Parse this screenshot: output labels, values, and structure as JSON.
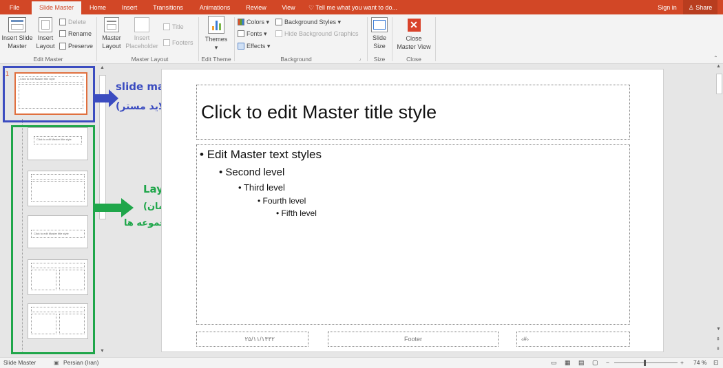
{
  "tabs": [
    "File",
    "Slide Master",
    "Home",
    "Insert",
    "Transitions",
    "Animations",
    "Review",
    "View"
  ],
  "tell_me": "Tell me what you want to do...",
  "sign_in": "Sign in",
  "share": "Share",
  "ribbon": {
    "insert_slide_master": [
      "Insert Slide",
      "Master"
    ],
    "insert_layout": [
      "Insert",
      "Layout"
    ],
    "delete": "Delete",
    "rename": "Rename",
    "preserve": "Preserve",
    "group_edit_master": "Edit Master",
    "master_layout": [
      "Master",
      "Layout"
    ],
    "insert_placeholder": [
      "Insert",
      "Placeholder"
    ],
    "title_cb": "Title",
    "footers_cb": "Footers",
    "group_master_layout": "Master Layout",
    "themes": "Themes",
    "group_edit_theme": "Edit Theme",
    "colors": "Colors",
    "fonts": "Fonts",
    "effects": "Effects",
    "background_styles": "Background Styles",
    "hide_bg": "Hide Background Graphics",
    "group_background": "Background",
    "slide_size": [
      "Slide",
      "Size"
    ],
    "group_size": "Size",
    "close_master": [
      "Close",
      "Master View"
    ],
    "group_close": "Close"
  },
  "thumb_number": "1",
  "thumb_title": "Click to edit Master title style",
  "slide": {
    "title": "Click to edit Master title style",
    "levels": [
      "Edit Master text styles",
      "Second level",
      "Third level",
      "Fourth level",
      "Fifth level"
    ],
    "date": "۲۵/۱۱/۱۴۴۲",
    "footer": "Footer",
    "number": "‹#›"
  },
  "annotations": {
    "slide_master": "slide master",
    "slide_master_fa": "(اسلاید مستر)",
    "layouts": "Layouts",
    "layouts_fa1": "(چیدمان،",
    "layouts_fa2": "زیر مجموعه ها)"
  },
  "status": {
    "view": "Slide Master",
    "language": "Persian (Iran)",
    "zoom": "74 %"
  },
  "colors": {
    "accent": "#d24726",
    "blue": "#3b4cc0",
    "green": "#1fa64a"
  }
}
